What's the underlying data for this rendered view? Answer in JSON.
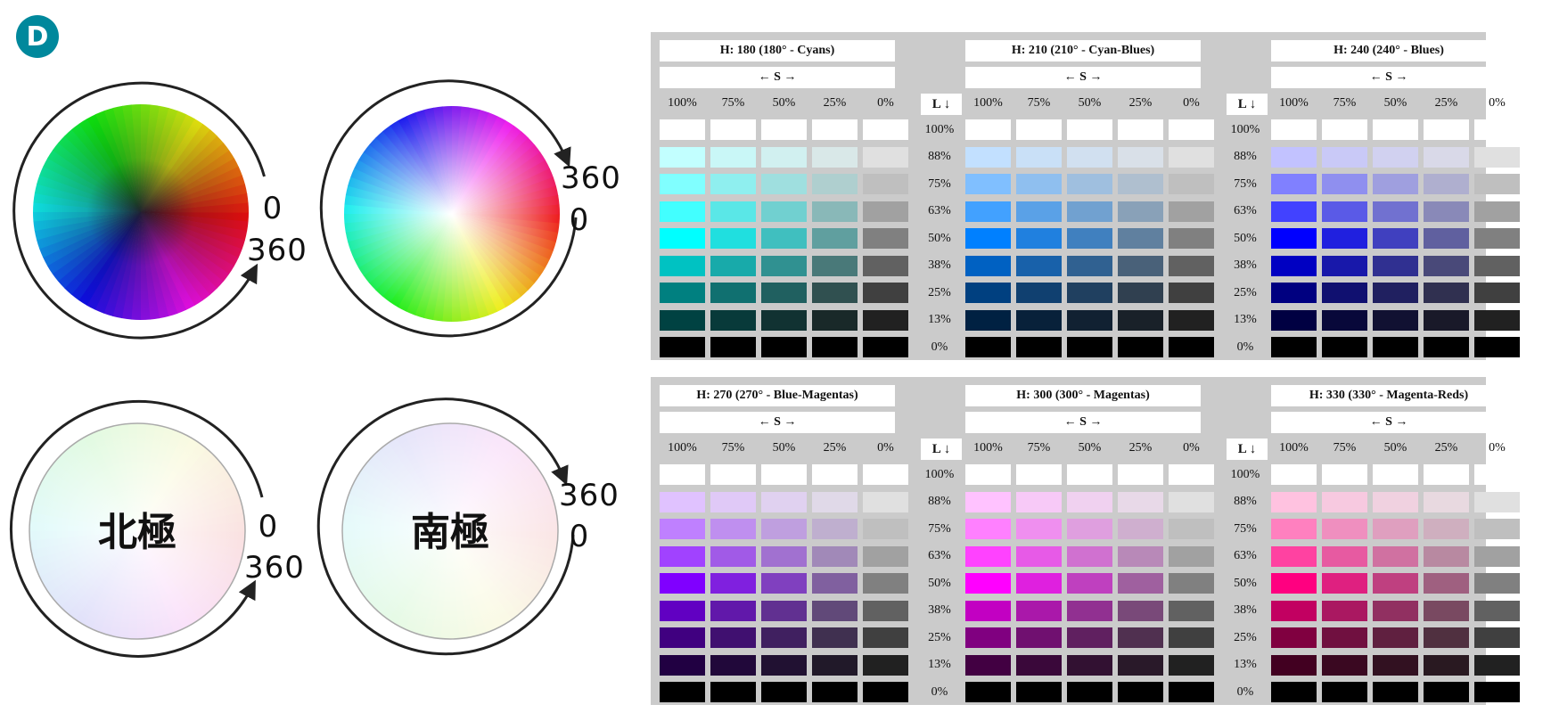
{
  "badge": "D",
  "wheels": {
    "ring_label_0": "0",
    "ring_label_360": "360",
    "north_pole": "北極",
    "south_pole": "南極"
  },
  "colors": {
    "badge": "#00889c",
    "panel_bg": "#cbcbcb"
  },
  "saturation_arrow": "← S →",
  "lightness_header": "L ↓",
  "saturation_levels": [
    "100%",
    "75%",
    "50%",
    "25%",
    "0%"
  ],
  "lightness_levels": [
    "100%",
    "88%",
    "75%",
    "63%",
    "50%",
    "38%",
    "25%",
    "13%",
    "0%"
  ],
  "lightness_values": [
    100,
    88,
    75,
    63,
    50,
    38,
    25,
    13,
    0
  ],
  "saturation_values": [
    100,
    75,
    50,
    25,
    0
  ],
  "panels": [
    {
      "groups": [
        {
          "title": "H: 180 (180° - Cyans)",
          "hue": 180
        },
        {
          "title": "H: 210 (210° - Cyan-Blues)",
          "hue": 210
        },
        {
          "title": "H: 240 (240° - Blues)",
          "hue": 240
        }
      ]
    },
    {
      "groups": [
        {
          "title": "H: 270 (270° - Blue-Magentas)",
          "hue": 270
        },
        {
          "title": "H: 300 (300° - Magentas)",
          "hue": 300
        },
        {
          "title": "H: 330 (330° - Magenta-Reds)",
          "hue": 330
        }
      ]
    }
  ]
}
